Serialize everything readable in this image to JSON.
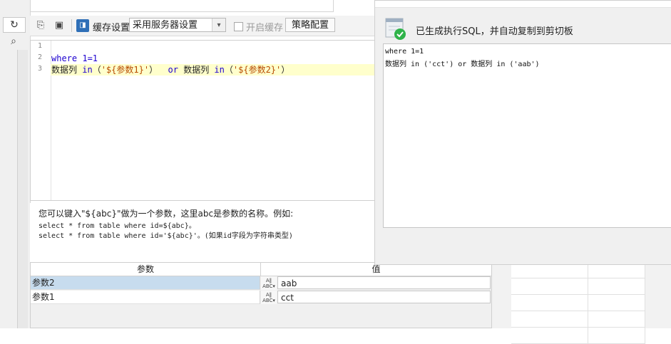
{
  "toolbar": {
    "cache_label": "缓存设置",
    "cache_select_value": "采用服务器设置",
    "enable_cache_label": "开启缓存",
    "strategy_button": "策略配置"
  },
  "editor": {
    "line_numbers": [
      "1",
      "2",
      "3"
    ],
    "lines": [
      [],
      [
        {
          "t": "where ",
          "c": "kw"
        },
        {
          "t": "1=1",
          "c": "num"
        }
      ],
      [
        {
          "t": "数据列 ",
          "c": ""
        },
        {
          "t": "in",
          "c": "kw"
        },
        {
          "t": "（",
          "c": ""
        },
        {
          "t": "'${参数1}'",
          "c": "str"
        },
        {
          "t": "）  ",
          "c": ""
        },
        {
          "t": "or",
          "c": "kw"
        },
        {
          "t": " 数据列 ",
          "c": ""
        },
        {
          "t": "in",
          "c": "kw"
        },
        {
          "t": "（",
          "c": ""
        },
        {
          "t": "'${参数2}'",
          "c": "str"
        },
        {
          "t": "）",
          "c": ""
        }
      ]
    ],
    "highlighted_line": 3
  },
  "help": {
    "lines": [
      "您可以键入\"${abc}\"做为一个参数，这里abc是参数的名称。例如:",
      "select * from table where id=${abc}。",
      "select * from table where id='${abc}'。(如果id字段为字符串类型)"
    ]
  },
  "param_table": {
    "headers": [
      "参数",
      "值"
    ],
    "type_icon_text": [
      "A‖",
      "ABC▾"
    ],
    "rows": [
      {
        "name": "参数2",
        "value": "aab",
        "selected": true
      },
      {
        "name": "参数1",
        "value": "cct",
        "selected": false
      }
    ]
  },
  "dialog": {
    "message": "已生成执行SQL，并自动复制到剪切板",
    "output_lines": [
      "where 1=1",
      "数据列 in ('cct') or 数据列 in ('aab')"
    ],
    "icon_accent": "#2fb34a"
  },
  "colors": {
    "keyword": "#1c00cf",
    "string": "#b84a00",
    "line_highlight": "#ffffcc",
    "selected_row": "#c7dcee"
  }
}
